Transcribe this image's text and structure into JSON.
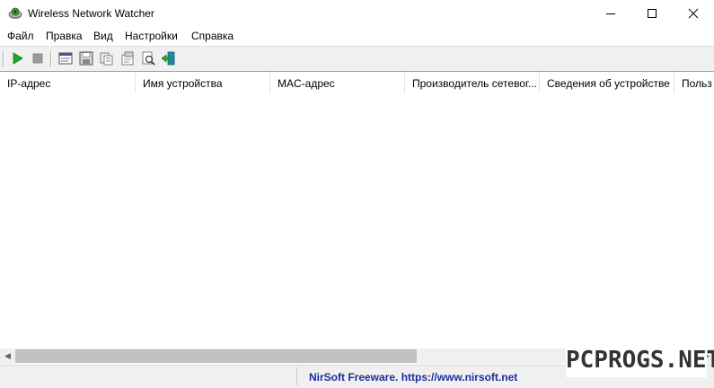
{
  "window": {
    "title": "Wireless Network Watcher"
  },
  "menu": [
    "Файл",
    "Правка",
    "Вид",
    "Настройки",
    "Справка"
  ],
  "toolbar": {
    "buttons": [
      "start-icon",
      "stop-icon",
      "html-report-icon",
      "save-icon",
      "copy-icon",
      "properties-icon",
      "find-icon",
      "exit-icon"
    ]
  },
  "columns": [
    "IP-адрес",
    "Имя устройства",
    "MAC-адрес",
    "Производитель сетевог...",
    "Сведения об устройстве",
    "Польз"
  ],
  "scrollbar": {
    "position": 0.0
  },
  "status": {
    "link": "NirSoft Freeware. https://www.nirsoft.net"
  },
  "watermark": "PCPROGS.NET",
  "colors": {
    "play": "#22a52a",
    "stop": "#909090",
    "link": "#1a2e9a"
  }
}
